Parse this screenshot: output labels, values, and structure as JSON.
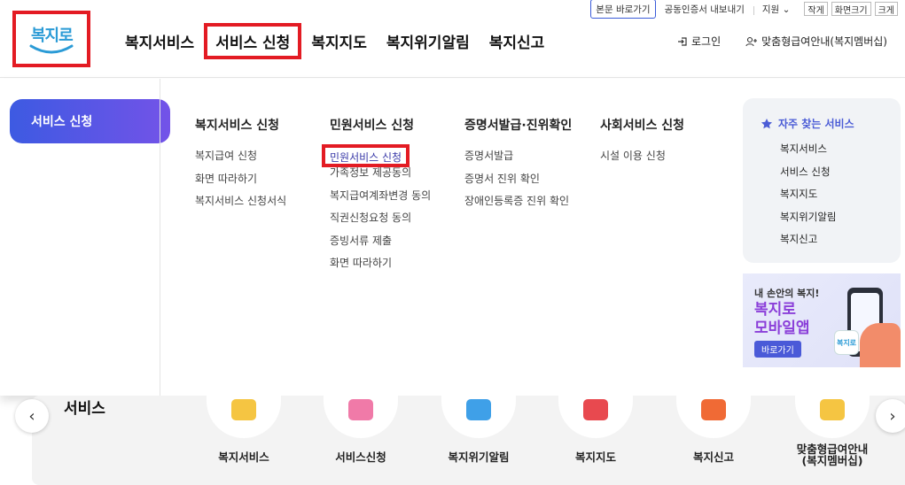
{
  "utility": {
    "skip": "본문 바로가기",
    "cert": "공동인증서 내보내기",
    "support": "지원",
    "small": "작게",
    "normal": "화면크기",
    "large": "크게"
  },
  "logo": {
    "text": "복지로"
  },
  "gnb": [
    {
      "label": "복지서비스"
    },
    {
      "label": "서비스 신청"
    },
    {
      "label": "복지지도"
    },
    {
      "label": "복지위기알림"
    },
    {
      "label": "복지신고"
    }
  ],
  "header_right": {
    "login": "로그인",
    "membership": "맞춤형급여안내(복지멤버십)"
  },
  "mega": {
    "side_tab": "서비스 신청",
    "columns": [
      {
        "title": "복지서비스 신청",
        "items": [
          "복지급여 신청",
          "화면 따라하기",
          "복지서비스 신청서식"
        ]
      },
      {
        "title": "민원서비스 신청",
        "items": [
          "민원서비스 신청",
          "가족정보 제공동의",
          "복지급여계좌변경 동의",
          "직권신청요청 동의",
          "증빙서류 제출",
          "화면 따라하기"
        ]
      },
      {
        "title": "증명서발급·진위확인",
        "items": [
          "증명서발급",
          "증명서 진위 확인",
          "장애인등록증 진위 확인"
        ]
      },
      {
        "title": "사회서비스 신청",
        "items": [
          "시설 이용 신청"
        ]
      }
    ],
    "favorites": {
      "title": "자주 찾는 서비스",
      "items": [
        "복지서비스",
        "서비스 신청",
        "복지지도",
        "복지위기알림",
        "복지신고"
      ]
    },
    "banner": {
      "line1": "내 손안의 복지!",
      "line2": "복지로",
      "line3": "모바일앱",
      "button": "바로가기",
      "app_label": "복지로"
    }
  },
  "strip": {
    "title": "서비스",
    "items": [
      {
        "label": "복지서비스",
        "color": "#f5c542"
      },
      {
        "label": "서비스신청",
        "color": "#f07aa8"
      },
      {
        "label": "복지위기알림",
        "color": "#3fa0e8"
      },
      {
        "label": "복지지도",
        "color": "#e8494f"
      },
      {
        "label": "복지신고",
        "color": "#f06a35"
      },
      {
        "label": "맞춤형급여안내\n(복지멤버십)",
        "color": "#f5c542"
      }
    ]
  }
}
